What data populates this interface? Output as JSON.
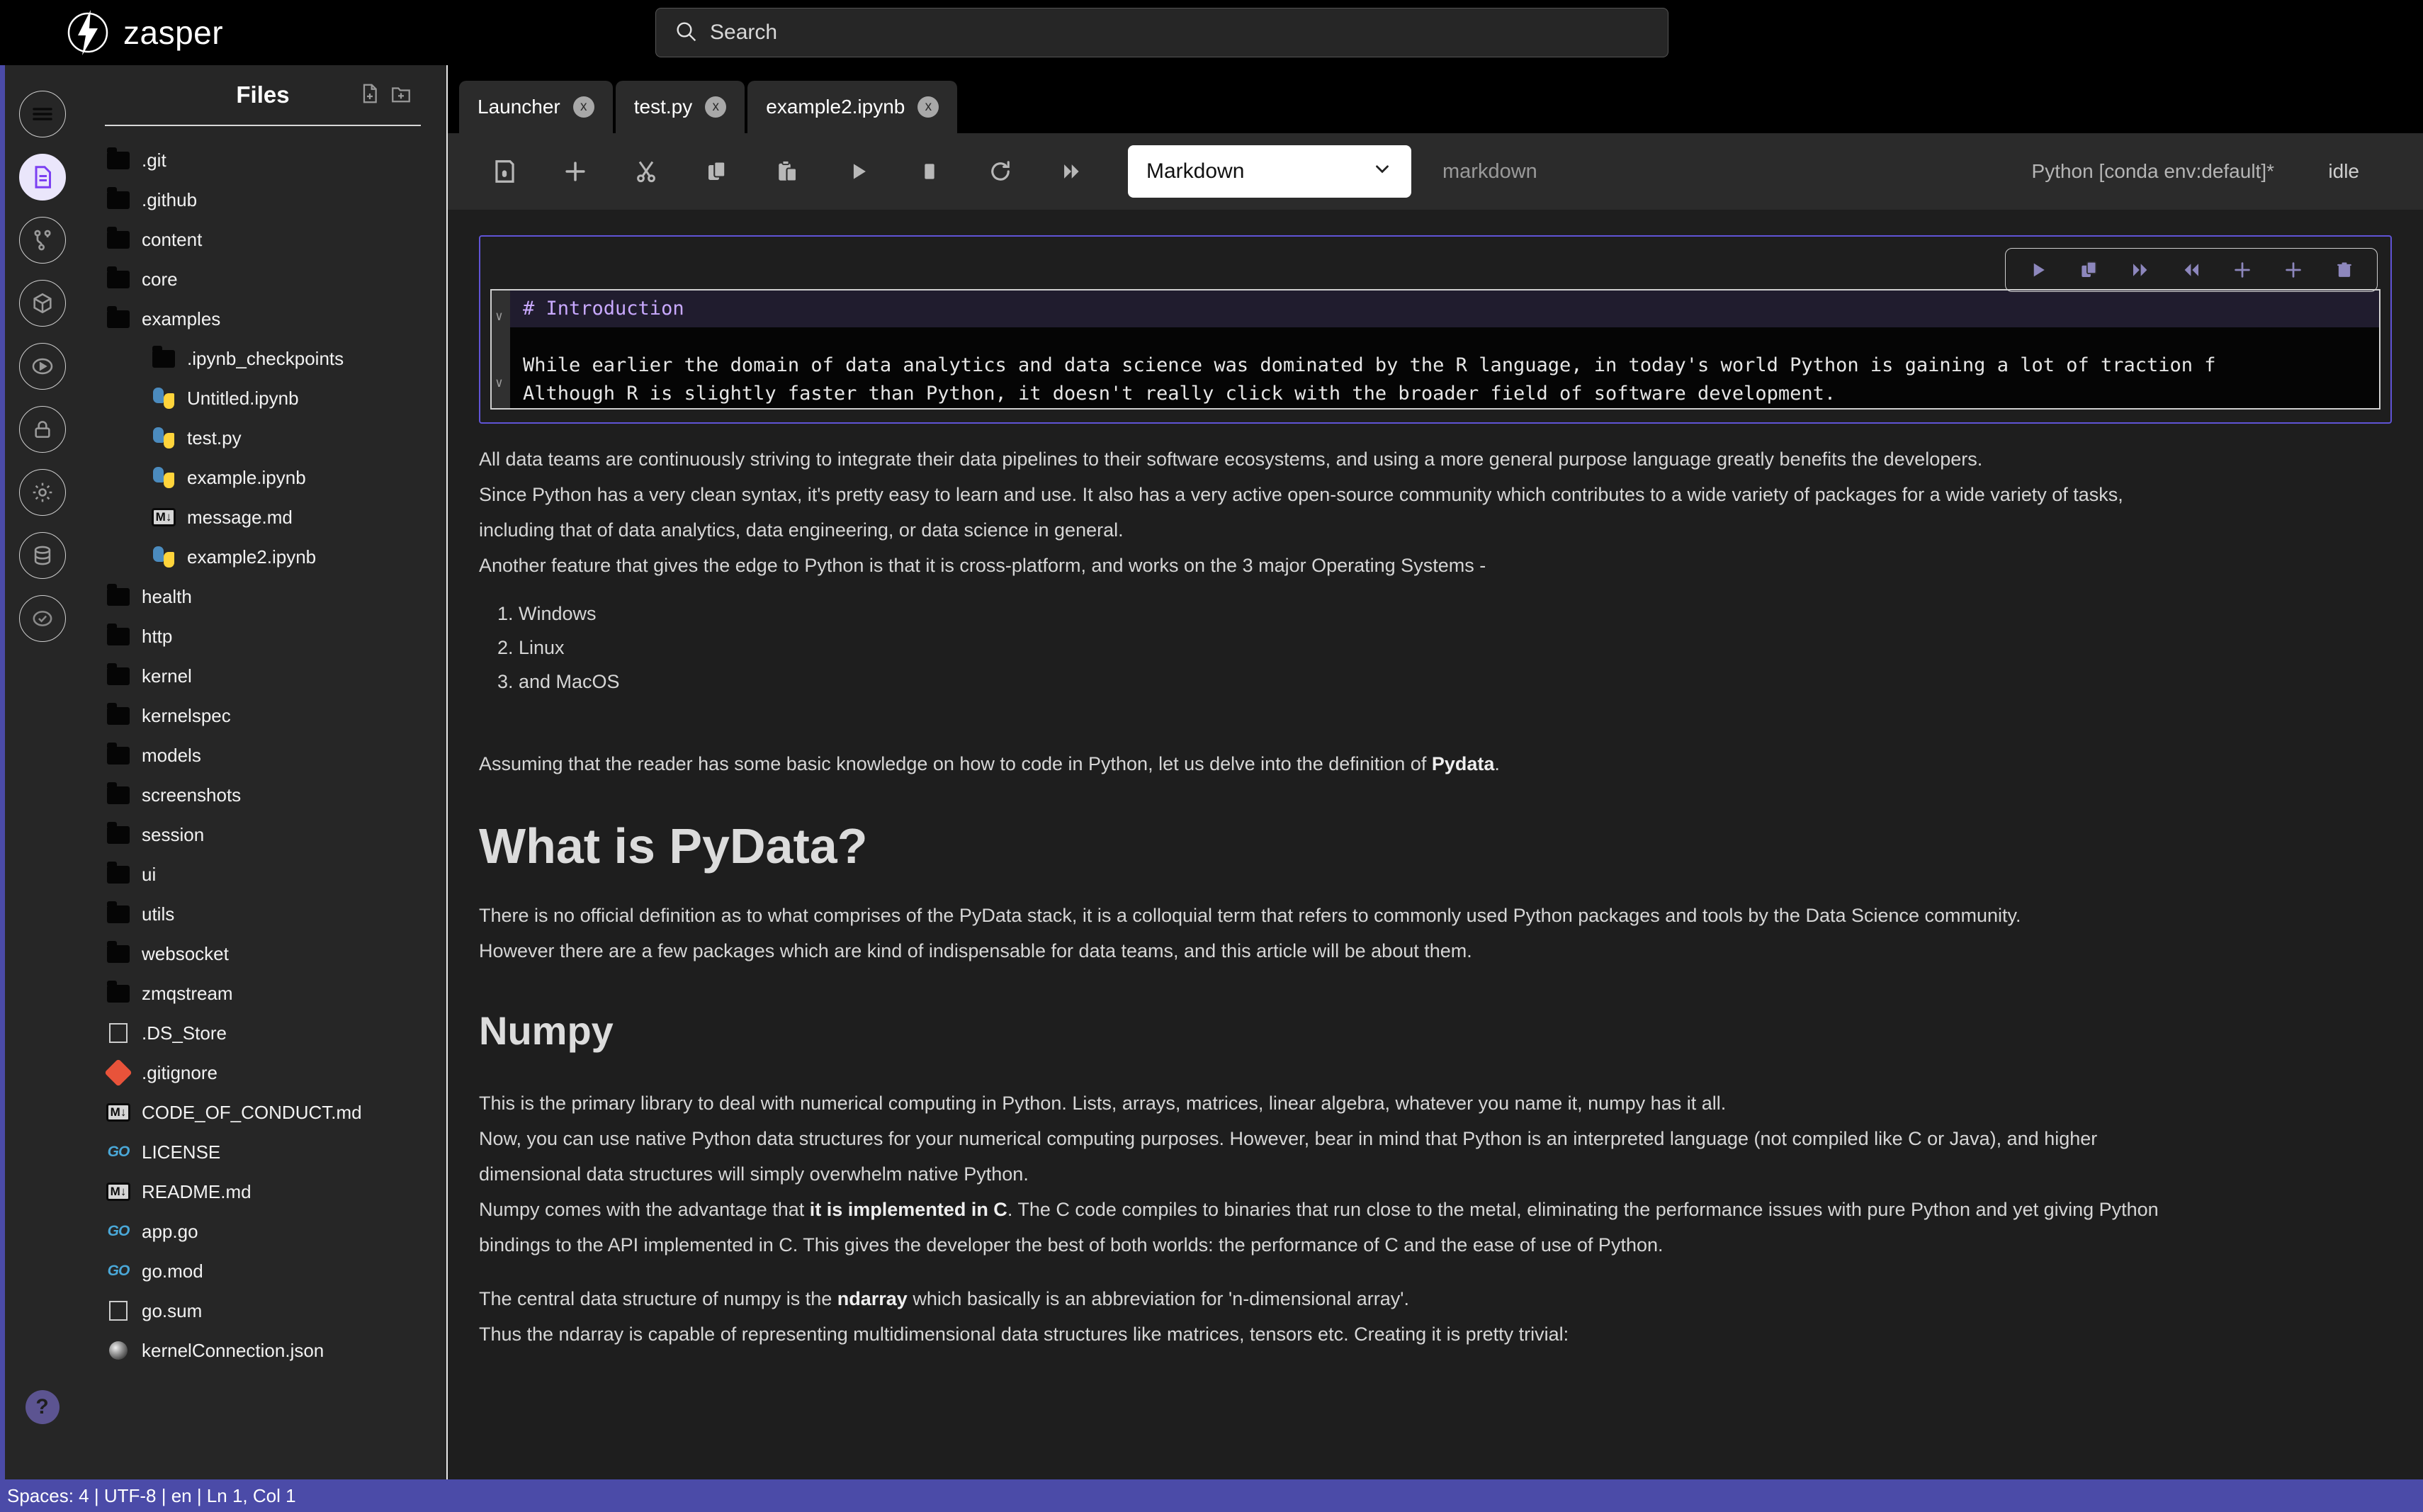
{
  "app": {
    "brand": "zasper"
  },
  "search": {
    "placeholder": "Search",
    "icon": "search-icon"
  },
  "rail": {
    "items": [
      {
        "name": "menu-icon",
        "label": "Menu",
        "active": false
      },
      {
        "name": "files-icon",
        "label": "Files",
        "active": true
      },
      {
        "name": "git-branch-icon",
        "label": "Source Control",
        "active": false
      },
      {
        "name": "package-icon",
        "label": "Packages",
        "active": false
      },
      {
        "name": "play-circle-icon",
        "label": "Run",
        "active": false
      },
      {
        "name": "lock-icon",
        "label": "Secrets",
        "active": false
      },
      {
        "name": "gear-icon",
        "label": "Settings",
        "active": false
      },
      {
        "name": "database-icon",
        "label": "Database",
        "active": false
      },
      {
        "name": "check-circle-icon",
        "label": "Checks",
        "active": false
      }
    ],
    "help_label": "?"
  },
  "files": {
    "title": "Files",
    "new_file_label": "New File",
    "new_folder_label": "New Folder",
    "tree": [
      {
        "label": ".git",
        "type": "folder",
        "depth": 1
      },
      {
        "label": ".github",
        "type": "folder",
        "depth": 1
      },
      {
        "label": "content",
        "type": "folder",
        "depth": 1
      },
      {
        "label": "core",
        "type": "folder",
        "depth": 1
      },
      {
        "label": "examples",
        "type": "folder",
        "depth": 1
      },
      {
        "label": ".ipynb_checkpoints",
        "type": "folder",
        "depth": 2
      },
      {
        "label": "Untitled.ipynb",
        "type": "python",
        "depth": 2
      },
      {
        "label": "test.py",
        "type": "python",
        "depth": 2
      },
      {
        "label": "example.ipynb",
        "type": "python",
        "depth": 2
      },
      {
        "label": "message.md",
        "type": "markdown",
        "depth": 2
      },
      {
        "label": "example2.ipynb",
        "type": "python",
        "depth": 2
      },
      {
        "label": "health",
        "type": "folder",
        "depth": 1
      },
      {
        "label": "http",
        "type": "folder",
        "depth": 1
      },
      {
        "label": "kernel",
        "type": "folder",
        "depth": 1
      },
      {
        "label": "kernelspec",
        "type": "folder",
        "depth": 1
      },
      {
        "label": "models",
        "type": "folder",
        "depth": 1
      },
      {
        "label": "screenshots",
        "type": "folder",
        "depth": 1
      },
      {
        "label": "session",
        "type": "folder",
        "depth": 1
      },
      {
        "label": "ui",
        "type": "folder",
        "depth": 1
      },
      {
        "label": "utils",
        "type": "folder",
        "depth": 1
      },
      {
        "label": "websocket",
        "type": "folder",
        "depth": 1
      },
      {
        "label": "zmqstream",
        "type": "folder",
        "depth": 1
      },
      {
        "label": ".DS_Store",
        "type": "file",
        "depth": 1
      },
      {
        "label": ".gitignore",
        "type": "git",
        "depth": 1
      },
      {
        "label": "CODE_OF_CONDUCT.md",
        "type": "markdown",
        "depth": 1
      },
      {
        "label": "LICENSE",
        "type": "go",
        "depth": 1
      },
      {
        "label": "README.md",
        "type": "markdown",
        "depth": 1
      },
      {
        "label": "app.go",
        "type": "go",
        "depth": 1
      },
      {
        "label": "go.mod",
        "type": "go",
        "depth": 1
      },
      {
        "label": "go.sum",
        "type": "file",
        "depth": 1
      },
      {
        "label": "kernelConnection.json",
        "type": "json",
        "depth": 1
      }
    ]
  },
  "tabs": [
    {
      "label": "Launcher",
      "close": "x",
      "active": false
    },
    {
      "label": "test.py",
      "close": "x",
      "active": false
    },
    {
      "label": "example2.ipynb",
      "close": "x",
      "active": true
    }
  ],
  "toolbar": {
    "icons": [
      {
        "name": "save-icon",
        "label": "Save"
      },
      {
        "name": "add-cell-icon",
        "label": "Insert cell"
      },
      {
        "name": "cut-icon",
        "label": "Cut"
      },
      {
        "name": "copy-icon",
        "label": "Copy"
      },
      {
        "name": "paste-icon",
        "label": "Paste"
      },
      {
        "name": "run-icon",
        "label": "Run"
      },
      {
        "name": "stop-icon",
        "label": "Stop"
      },
      {
        "name": "restart-icon",
        "label": "Restart"
      },
      {
        "name": "run-all-icon",
        "label": "Run All"
      }
    ],
    "cell_type": "Markdown",
    "cell_type_caret": "chevron-down-icon",
    "cell_kind_label": "markdown",
    "kernel": "Python [conda env:default]*",
    "kernel_state": "idle"
  },
  "cell": {
    "tools": [
      {
        "name": "run-cell-icon",
        "label": "Run cell"
      },
      {
        "name": "duplicate-cell-icon",
        "label": "Duplicate cell"
      },
      {
        "name": "move-cell-down-icon",
        "label": "Move down"
      },
      {
        "name": "move-cell-up-icon",
        "label": "Move up"
      },
      {
        "name": "add-cell-above-icon",
        "label": "Add above"
      },
      {
        "name": "add-cell-below-icon",
        "label": "Add below"
      },
      {
        "name": "delete-cell-icon",
        "label": "Delete cell"
      }
    ],
    "source_heading": "# Introduction",
    "source_line_1": "While earlier the domain of data analytics and data science was dominated by the R language, in today's world Python is gaining a lot of traction f",
    "source_line_2": "Although R is slightly faster than Python, it doesn't really click with the broader field of software development.",
    "fold_marker": "∨"
  },
  "content": {
    "p1": "All data teams are continuously striving to integrate their data pipelines to their software ecosystems, and using a more general purpose language greatly benefits the developers.",
    "p2": "Since Python has a very clean syntax, it's pretty easy to learn and use. It also has a very active open-source community which contributes to a wide variety of packages for a wide variety of tasks,",
    "p3": "including that of data analytics, data engineering, or data science in general.",
    "p4": "Another feature that gives the edge to Python is that it is cross-platform, and works on the 3 major Operating Systems -",
    "os_list": [
      "Windows",
      "Linux",
      "and MacOS"
    ],
    "p5_pre": "Assuming that the reader has some basic knowledge on how to code in Python, let us delve into the definition of ",
    "p5_bold": "Pydata",
    "p5_post": ".",
    "h1": "What is PyData?",
    "p6": "There is no official definition as to what comprises of the PyData stack, it is a colloquial term that refers to commonly used Python packages and tools by the Data Science community.",
    "p7": "However there are a few packages which are kind of indispensable for data teams, and this article will be about them.",
    "h2": "Numpy",
    "p8": "This is the primary library to deal with numerical computing in Python. Lists, arrays, matrices, linear algebra, whatever you name it, numpy has it all.",
    "p9": "Now, you can use native Python data structures for your numerical computing purposes. However, bear in mind that Python is an interpreted language (not compiled like C or Java), and higher",
    "p10": "dimensional data structures will simply overwhelm native Python.",
    "p11_pre": "Numpy comes with the advantage that ",
    "p11_bold": "it is implemented in C",
    "p11_post": ". The C code compiles to binaries that run close to the metal, eliminating the performance issues with pure Python and yet giving Python",
    "p12": "bindings to the API implemented in C. This gives the developer the best of both worlds: the performance of C and the ease of use of Python.",
    "p13_pre": "The central data structure of numpy is the ",
    "p13_bold": "ndarray",
    "p13_post": " which basically is an abbreviation for 'n-dimensional array'.",
    "p14": "Thus the ndarray is capable of representing multidimensional data structures like matrices, tensors etc. Creating it is pretty trivial:"
  },
  "statusbar": {
    "text": "Spaces: 4 | UTF-8 | en | Ln 1, Col 1"
  },
  "colors": {
    "accent": "#4b4ba8",
    "cell_border": "#6054d6",
    "panel_bg": "#262626",
    "editor_bg": "#050505",
    "heading_purple": "#c9a9ff"
  }
}
